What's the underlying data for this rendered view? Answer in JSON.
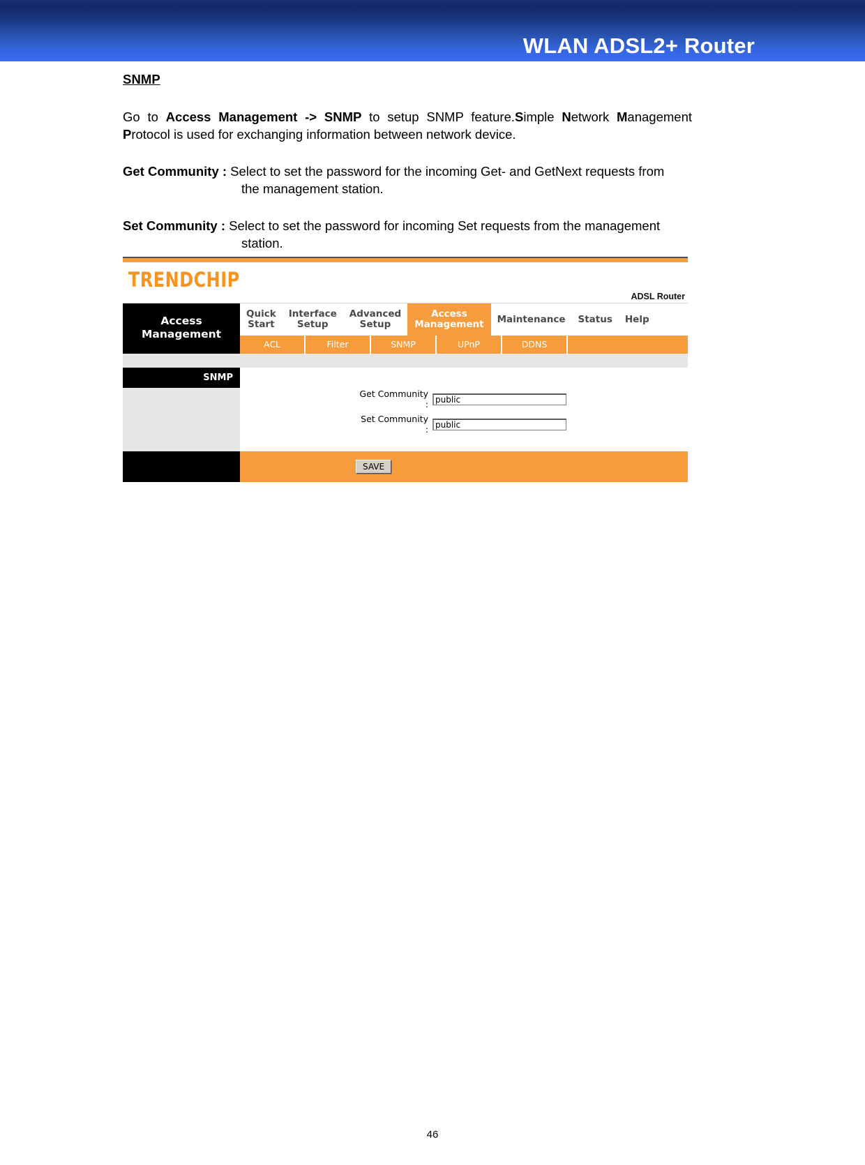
{
  "banner": {
    "title": "WLAN ADSL2+ Router"
  },
  "document": {
    "heading": "SNMP",
    "intro": {
      "prefix": "Go to ",
      "bold_path": "Access Management -> SNMP",
      "middle": " to setup SNMP feature.",
      "s": "S",
      "s_rest": "imple ",
      "n": "N",
      "n_rest": "etwork ",
      "m": "M",
      "m_rest": "anagement ",
      "p": "P",
      "p_rest": "rotocol is used for exchanging information between network device."
    },
    "definitions": [
      {
        "term": "Get Community :",
        "text": " Select to set the password for the incoming Get- and GetNext requests from",
        "continuation": "the management station."
      },
      {
        "term": "Set Community :",
        "text": " Select to set the password for incoming Set requests from the management",
        "continuation": "station."
      }
    ]
  },
  "router_ui": {
    "logo": "TRENDCHIP",
    "model": "ADSL Router",
    "side_header": "Access\nManagement",
    "main_tabs": [
      {
        "label": "Quick\nStart",
        "active": false
      },
      {
        "label": "Interface\nSetup",
        "active": false
      },
      {
        "label": "Advanced\nSetup",
        "active": false
      },
      {
        "label": "Access\nManagement",
        "active": true
      },
      {
        "label": "Maintenance",
        "active": false
      },
      {
        "label": "Status",
        "active": false
      },
      {
        "label": "Help",
        "active": false
      }
    ],
    "sub_tabs": [
      {
        "label": "ACL"
      },
      {
        "label": "Filter"
      },
      {
        "label": "SNMP"
      },
      {
        "label": "UPnP"
      },
      {
        "label": "DDNS"
      }
    ],
    "section_title": "SNMP",
    "fields": [
      {
        "label": "Get Community :",
        "value": "public"
      },
      {
        "label": "Set Community :",
        "value": "public"
      }
    ],
    "save_label": "SAVE",
    "colors": {
      "orange": "#f79c3c",
      "black": "#000000",
      "grey_panel": "#e6e6e6",
      "logo_orange": "#f7941d"
    }
  },
  "footer": {
    "page_number": "46"
  }
}
